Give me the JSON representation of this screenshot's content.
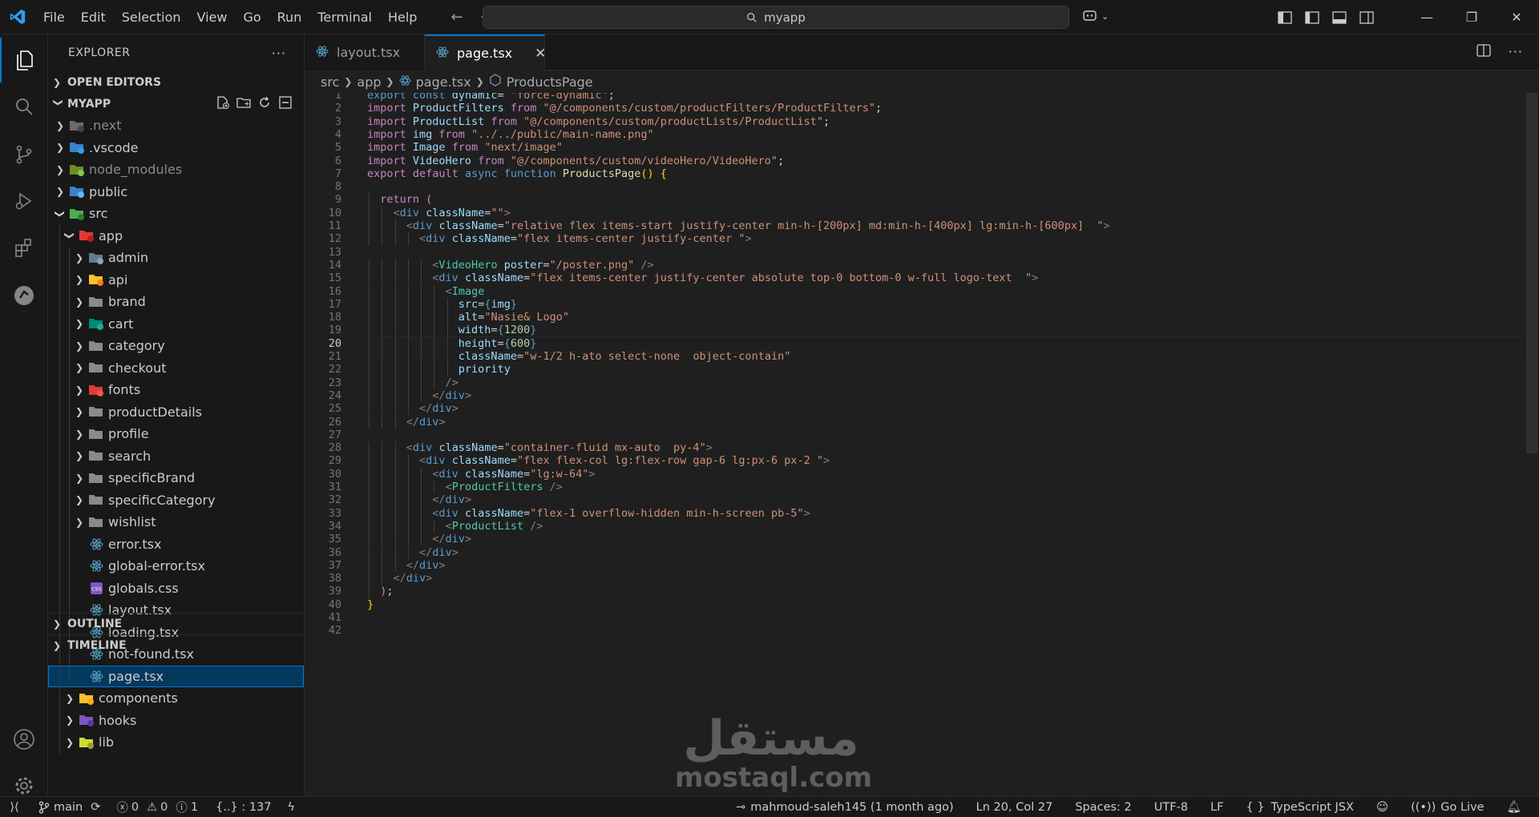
{
  "menu": [
    "File",
    "Edit",
    "Selection",
    "View",
    "Go",
    "Run",
    "Terminal",
    "Help"
  ],
  "command_center": {
    "text": "myapp"
  },
  "explorer": {
    "title": "EXPLORER",
    "open_editors": "OPEN EDITORS",
    "workspace": "MYAPP",
    "outline": "OUTLINE",
    "timeline": "TIMELINE"
  },
  "tree": [
    {
      "label": ".next",
      "depth": 0,
      "type": "folder",
      "icon": "next-folder-icon",
      "dim": true
    },
    {
      "label": ".vscode",
      "depth": 0,
      "type": "folder",
      "icon": "vscode-folder-icon"
    },
    {
      "label": "node_modules",
      "depth": 0,
      "type": "folder",
      "icon": "node-folder-icon",
      "dim": true
    },
    {
      "label": "public",
      "depth": 0,
      "type": "folder",
      "icon": "public-folder-icon"
    },
    {
      "label": "src",
      "depth": 0,
      "type": "folder-open",
      "icon": "src-folder-icon"
    },
    {
      "label": "app",
      "depth": 1,
      "type": "folder-open",
      "icon": "app-folder-icon"
    },
    {
      "label": "admin",
      "depth": 2,
      "type": "folder",
      "icon": "admin-folder-icon"
    },
    {
      "label": "api",
      "depth": 2,
      "type": "folder",
      "icon": "api-folder-icon"
    },
    {
      "label": "brand",
      "depth": 2,
      "type": "folder",
      "icon": "folder-icon"
    },
    {
      "label": "cart",
      "depth": 2,
      "type": "folder",
      "icon": "cart-folder-icon"
    },
    {
      "label": "category",
      "depth": 2,
      "type": "folder",
      "icon": "folder-icon"
    },
    {
      "label": "checkout",
      "depth": 2,
      "type": "folder",
      "icon": "folder-icon"
    },
    {
      "label": "fonts",
      "depth": 2,
      "type": "folder",
      "icon": "fonts-folder-icon"
    },
    {
      "label": "productDetails",
      "depth": 2,
      "type": "folder",
      "icon": "folder-icon"
    },
    {
      "label": "profile",
      "depth": 2,
      "type": "folder",
      "icon": "folder-icon"
    },
    {
      "label": "search",
      "depth": 2,
      "type": "folder",
      "icon": "folder-icon"
    },
    {
      "label": "specificBrand",
      "depth": 2,
      "type": "folder",
      "icon": "folder-icon"
    },
    {
      "label": "specificCategory",
      "depth": 2,
      "type": "folder",
      "icon": "folder-icon"
    },
    {
      "label": "wishlist",
      "depth": 2,
      "type": "folder",
      "icon": "folder-icon"
    },
    {
      "label": "error.tsx",
      "depth": 2,
      "type": "file",
      "icon": "react-icon"
    },
    {
      "label": "global-error.tsx",
      "depth": 2,
      "type": "file",
      "icon": "react-icon"
    },
    {
      "label": "globals.css",
      "depth": 2,
      "type": "file",
      "icon": "css-icon"
    },
    {
      "label": "layout.tsx",
      "depth": 2,
      "type": "file",
      "icon": "react-icon"
    },
    {
      "label": "loading.tsx",
      "depth": 2,
      "type": "file",
      "icon": "react-icon"
    },
    {
      "label": "not-found.tsx",
      "depth": 2,
      "type": "file",
      "icon": "react-icon"
    },
    {
      "label": "page.tsx",
      "depth": 2,
      "type": "file",
      "icon": "react-icon",
      "selected": true
    },
    {
      "label": "components",
      "depth": 1,
      "type": "folder",
      "icon": "components-folder-icon"
    },
    {
      "label": "hooks",
      "depth": 1,
      "type": "folder",
      "icon": "hooks-folder-icon"
    },
    {
      "label": "lib",
      "depth": 1,
      "type": "folder",
      "icon": "lib-folder-icon"
    }
  ],
  "tabs": [
    {
      "label": "layout.tsx",
      "active": false
    },
    {
      "label": "page.tsx",
      "active": true
    }
  ],
  "breadcrumb": {
    "p1": "src",
    "p2": "app",
    "p3": "page.tsx",
    "p4": "ProductsPage"
  },
  "code_lines": [
    [
      [
        "k",
        "export "
      ],
      [
        "k",
        "const "
      ],
      [
        "v",
        "dynamic"
      ],
      [
        "",
        "= "
      ],
      [
        "s",
        "\"force-dynamic\""
      ],
      [
        "",
        ";"
      ]
    ],
    [
      [
        "c",
        "import "
      ],
      [
        "v",
        "ProductFilters "
      ],
      [
        "c",
        "from "
      ],
      [
        "s",
        "\"@/components/custom/productFilters/ProductFilters\""
      ],
      [
        "",
        ";"
      ]
    ],
    [
      [
        "c",
        "import "
      ],
      [
        "v",
        "ProductList "
      ],
      [
        "c",
        "from "
      ],
      [
        "s",
        "\"@/components/custom/productLists/ProductList\""
      ],
      [
        "",
        ";"
      ]
    ],
    [
      [
        "c",
        "import "
      ],
      [
        "v",
        "img "
      ],
      [
        "c",
        "from "
      ],
      [
        "s",
        "\"../../public/main-name.png\""
      ]
    ],
    [
      [
        "c",
        "import "
      ],
      [
        "v",
        "Image "
      ],
      [
        "c",
        "from "
      ],
      [
        "s",
        "\"next/image\""
      ]
    ],
    [
      [
        "c",
        "import "
      ],
      [
        "v",
        "VideoHero "
      ],
      [
        "c",
        "from "
      ],
      [
        "s",
        "\"@/components/custom/videoHero/VideoHero\""
      ],
      [
        "",
        ";"
      ]
    ],
    [
      [
        "c",
        "export "
      ],
      [
        "c",
        "default "
      ],
      [
        "k",
        "async "
      ],
      [
        "k",
        "function "
      ],
      [
        "f",
        "ProductsPage"
      ],
      [
        "y",
        "() {"
      ]
    ],
    [],
    [
      [
        "",
        "  "
      ],
      [
        "c",
        "return "
      ],
      [
        "c",
        "("
      ]
    ],
    [
      [
        "",
        "    "
      ],
      [
        "p",
        "<"
      ],
      [
        "k",
        "div "
      ],
      [
        "a",
        "className"
      ],
      [
        "",
        "="
      ],
      [
        "s",
        "\"\""
      ],
      [
        "p",
        ">"
      ]
    ],
    [
      [
        "",
        "      "
      ],
      [
        "p",
        "<"
      ],
      [
        "k",
        "div "
      ],
      [
        "a",
        "className"
      ],
      [
        "",
        "="
      ],
      [
        "s",
        "\"relative flex items-start justify-center min-h-[200px] md:min-h-[400px] lg:min-h-[600px]  \""
      ],
      [
        "p",
        ">"
      ]
    ],
    [
      [
        "",
        "        "
      ],
      [
        "p",
        "<"
      ],
      [
        "k",
        "div "
      ],
      [
        "a",
        "className"
      ],
      [
        "",
        "="
      ],
      [
        "s",
        "\"flex items-center justify-center \""
      ],
      [
        "p",
        ">"
      ]
    ],
    [],
    [
      [
        "",
        "          "
      ],
      [
        "p",
        "<"
      ],
      [
        "t",
        "VideoHero "
      ],
      [
        "a",
        "poster"
      ],
      [
        "",
        "="
      ],
      [
        "s",
        "\"/poster.png\" "
      ],
      [
        "p",
        "/>"
      ]
    ],
    [
      [
        "",
        "          "
      ],
      [
        "p",
        "<"
      ],
      [
        "k",
        "div "
      ],
      [
        "a",
        "className"
      ],
      [
        "",
        "="
      ],
      [
        "s",
        "\"flex items-center justify-center absolute top-0 bottom-0 w-full logo-text  \""
      ],
      [
        "p",
        ">"
      ]
    ],
    [
      [
        "",
        "            "
      ],
      [
        "p",
        "<"
      ],
      [
        "t",
        "Image"
      ]
    ],
    [
      [
        "",
        "              "
      ],
      [
        "a",
        "src"
      ],
      [
        "",
        "="
      ],
      [
        "k",
        "{"
      ],
      [
        "v",
        "img"
      ],
      [
        "k",
        "}"
      ]
    ],
    [
      [
        "",
        "              "
      ],
      [
        "a",
        "alt"
      ],
      [
        "",
        "="
      ],
      [
        "s",
        "\"Nasie& Logo\""
      ]
    ],
    [
      [
        "",
        "              "
      ],
      [
        "a",
        "width"
      ],
      [
        "",
        "="
      ],
      [
        "k",
        "{"
      ],
      [
        "n",
        "1200"
      ],
      [
        "k",
        "}"
      ]
    ],
    [
      [
        "",
        "              "
      ],
      [
        "a",
        "height"
      ],
      [
        "",
        "="
      ],
      [
        "k",
        "{"
      ],
      [
        "n",
        "600"
      ],
      [
        "k",
        "}"
      ]
    ],
    [
      [
        "",
        "              "
      ],
      [
        "a",
        "className"
      ],
      [
        "",
        "="
      ],
      [
        "s",
        "\"w-1/2 h-ato select-none  object-contain\""
      ]
    ],
    [
      [
        "",
        "              "
      ],
      [
        "a",
        "priority"
      ]
    ],
    [
      [
        "",
        "            "
      ],
      [
        "p",
        "/>"
      ]
    ],
    [
      [
        "",
        "          "
      ],
      [
        "p",
        "</"
      ],
      [
        "k",
        "div"
      ],
      [
        "p",
        ">"
      ]
    ],
    [
      [
        "",
        "        "
      ],
      [
        "p",
        "</"
      ],
      [
        "k",
        "div"
      ],
      [
        "p",
        ">"
      ]
    ],
    [
      [
        "",
        "      "
      ],
      [
        "p",
        "</"
      ],
      [
        "k",
        "div"
      ],
      [
        "p",
        ">"
      ]
    ],
    [],
    [
      [
        "",
        "      "
      ],
      [
        "p",
        "<"
      ],
      [
        "k",
        "div "
      ],
      [
        "a",
        "className"
      ],
      [
        "",
        "="
      ],
      [
        "s",
        "\"container-fluid mx-auto  py-4\""
      ],
      [
        "p",
        ">"
      ]
    ],
    [
      [
        "",
        "        "
      ],
      [
        "p",
        "<"
      ],
      [
        "k",
        "div "
      ],
      [
        "a",
        "className"
      ],
      [
        "",
        "="
      ],
      [
        "s",
        "\"flex flex-col lg:flex-row gap-6 lg:px-6 px-2 \""
      ],
      [
        "p",
        ">"
      ]
    ],
    [
      [
        "",
        "          "
      ],
      [
        "p",
        "<"
      ],
      [
        "k",
        "div "
      ],
      [
        "a",
        "className"
      ],
      [
        "",
        "="
      ],
      [
        "s",
        "\"lg:w-64\""
      ],
      [
        "p",
        ">"
      ]
    ],
    [
      [
        "",
        "            "
      ],
      [
        "p",
        "<"
      ],
      [
        "t",
        "ProductFilters "
      ],
      [
        "p",
        "/>"
      ]
    ],
    [
      [
        "",
        "          "
      ],
      [
        "p",
        "</"
      ],
      [
        "k",
        "div"
      ],
      [
        "p",
        ">"
      ]
    ],
    [
      [
        "",
        "          "
      ],
      [
        "p",
        "<"
      ],
      [
        "k",
        "div "
      ],
      [
        "a",
        "className"
      ],
      [
        "",
        "="
      ],
      [
        "s",
        "\"flex-1 overflow-hidden min-h-screen pb-5\""
      ],
      [
        "p",
        ">"
      ]
    ],
    [
      [
        "",
        "            "
      ],
      [
        "p",
        "<"
      ],
      [
        "t",
        "ProductList "
      ],
      [
        "p",
        "/>"
      ]
    ],
    [
      [
        "",
        "          "
      ],
      [
        "p",
        "</"
      ],
      [
        "k",
        "div"
      ],
      [
        "p",
        ">"
      ]
    ],
    [
      [
        "",
        "        "
      ],
      [
        "p",
        "</"
      ],
      [
        "k",
        "div"
      ],
      [
        "p",
        ">"
      ]
    ],
    [
      [
        "",
        "      "
      ],
      [
        "p",
        "</"
      ],
      [
        "k",
        "div"
      ],
      [
        "p",
        ">"
      ]
    ],
    [
      [
        "",
        "    "
      ],
      [
        "p",
        "</"
      ],
      [
        "k",
        "div"
      ],
      [
        "p",
        ">"
      ]
    ],
    [
      [
        "",
        "  "
      ],
      [
        "c",
        ")"
      ],
      [
        "",
        ";"
      ]
    ],
    [
      [
        "y",
        "}"
      ]
    ],
    [],
    []
  ],
  "current_line": 20,
  "watermark": {
    "arabic": "مستقل",
    "latin": "mostaql.com"
  },
  "status": {
    "branch": "main",
    "errors": "0",
    "warnings": "0",
    "info": "1",
    "braces": "{..} : 137",
    "blame": "mahmoud-saleh145 (1 month ago)",
    "position": "Ln 20, Col 27",
    "spaces": "Spaces: 2",
    "encoding": "UTF-8",
    "eol": "LF",
    "language": "TypeScript JSX",
    "golive": "Go Live"
  },
  "colors": {
    "accent": "#0078d4",
    "selection": "#04395e",
    "react": "#519aba"
  }
}
